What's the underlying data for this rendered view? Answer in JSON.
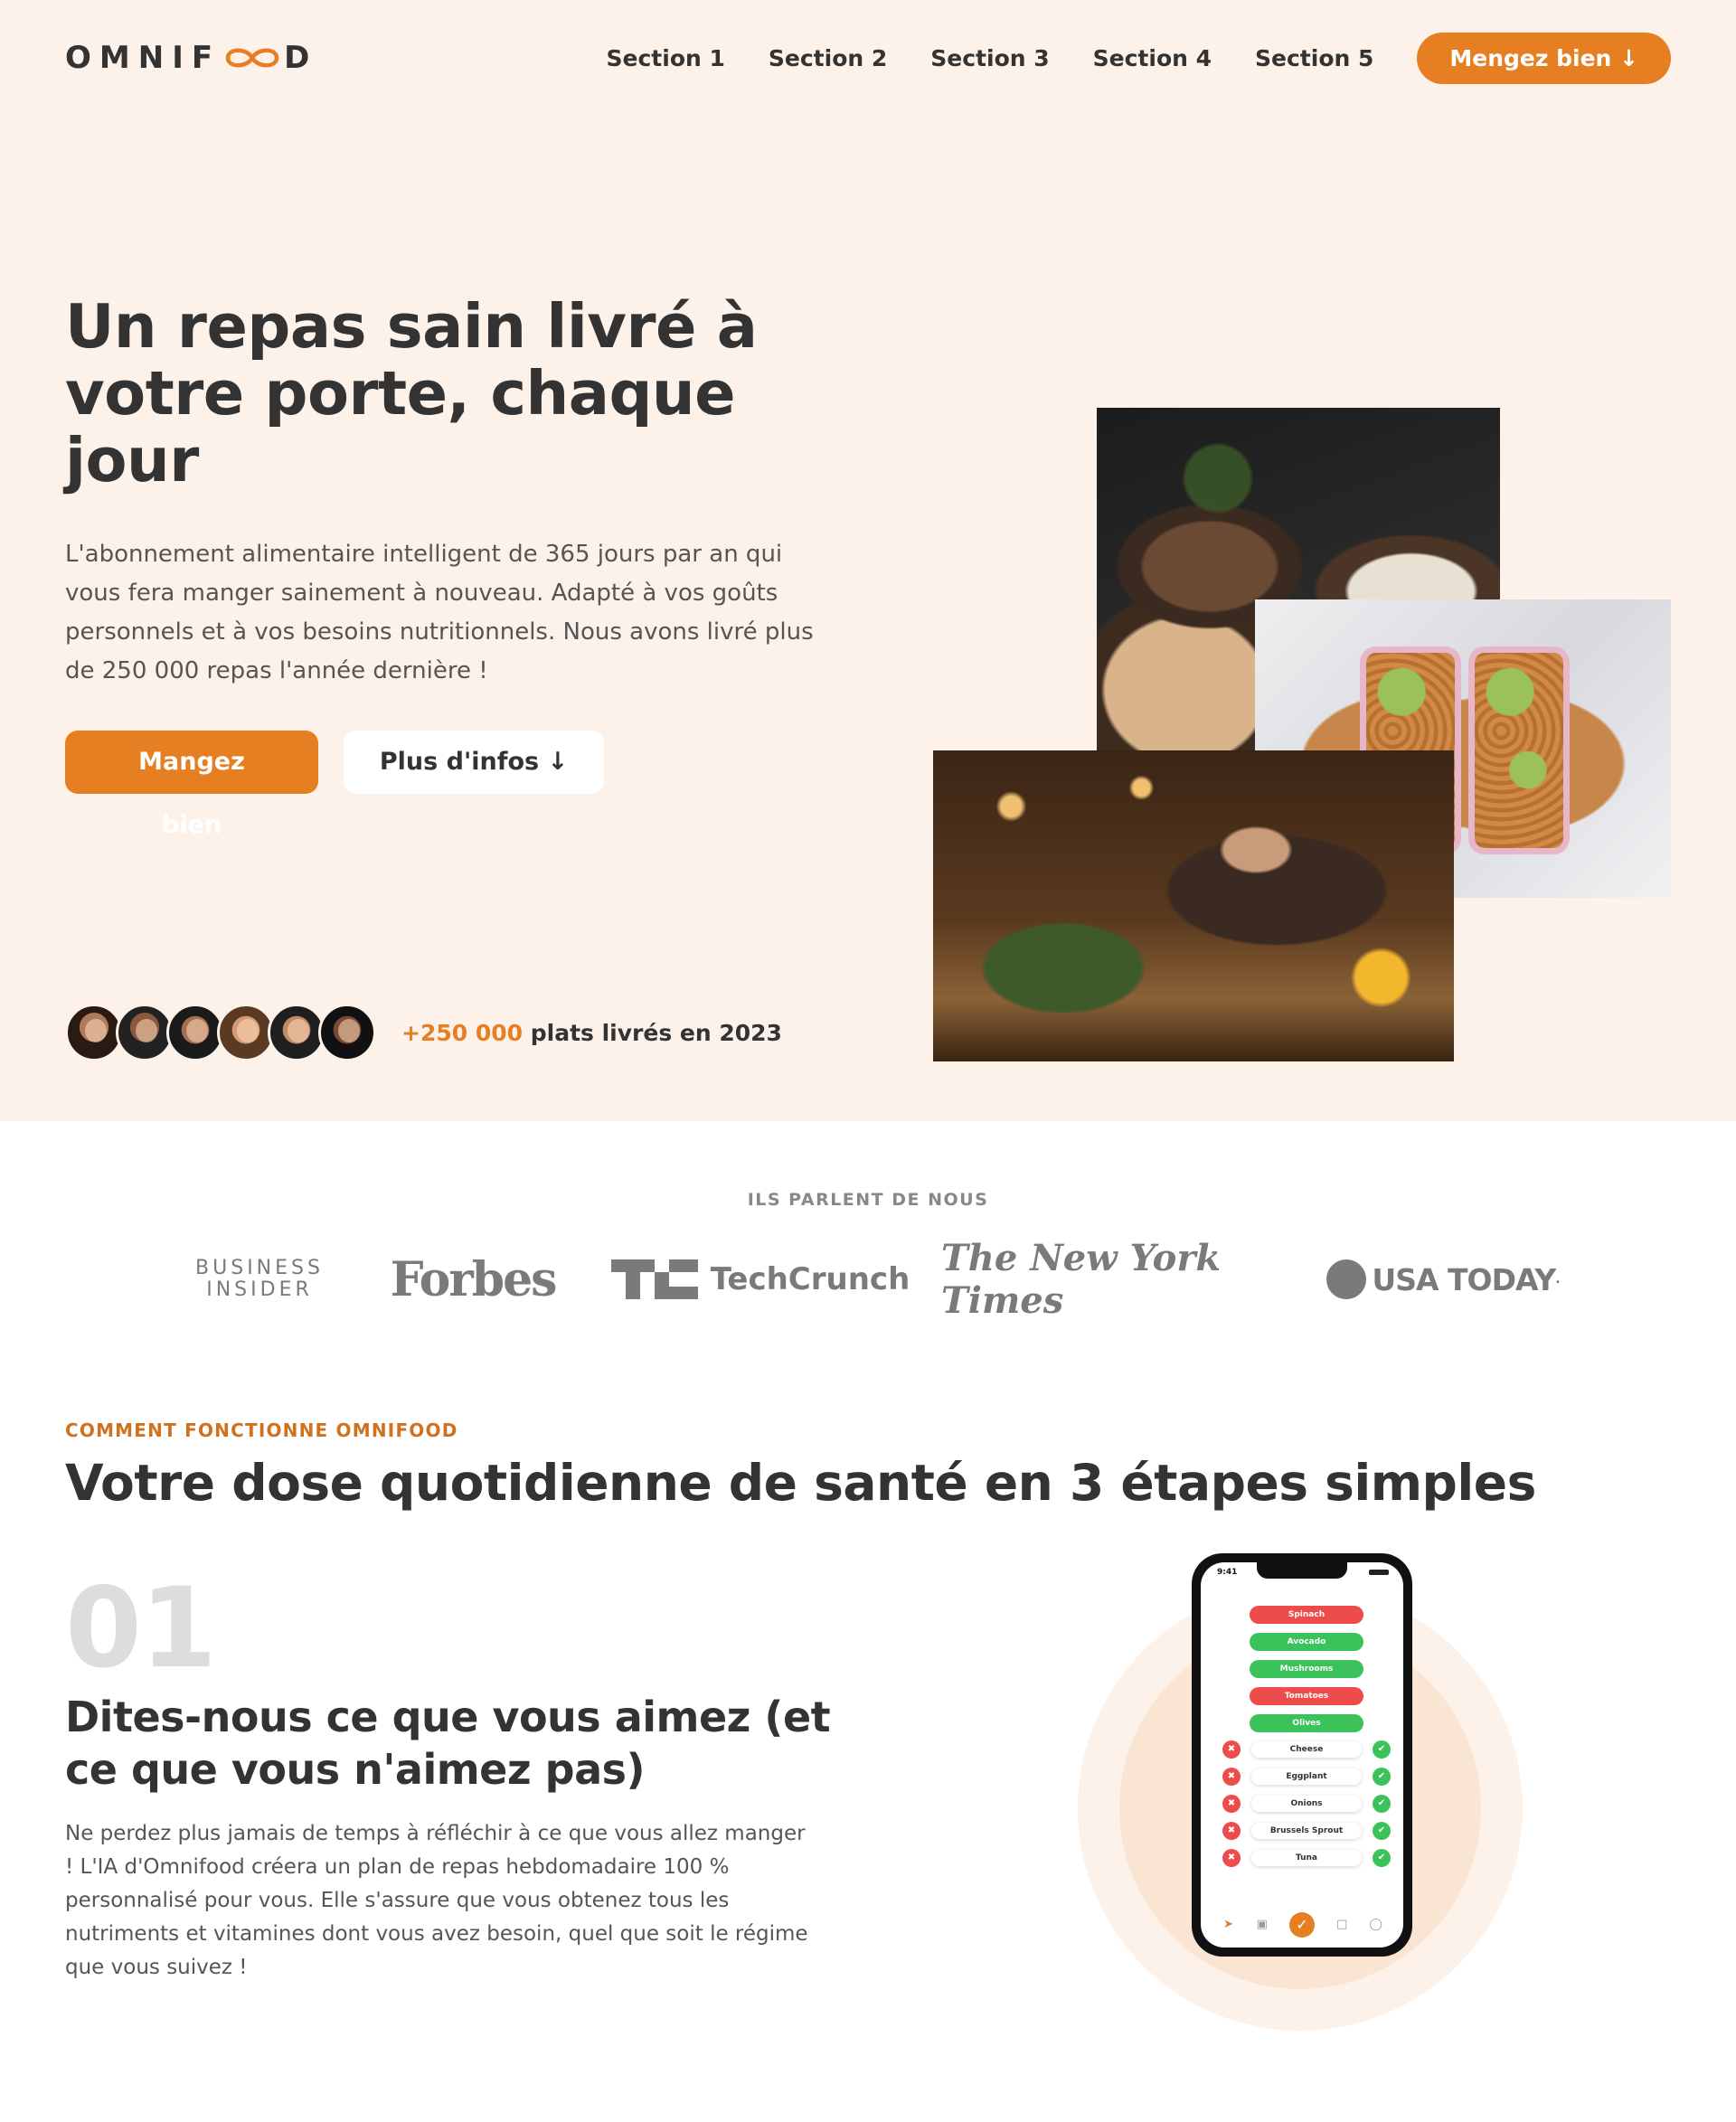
{
  "header": {
    "logo_left": "OMNIF",
    "logo_right": "D",
    "nav": [
      "Section 1",
      "Section 2",
      "Section 3",
      "Section 4",
      "Section 5"
    ],
    "cta": "Mengez bien ↓"
  },
  "hero": {
    "title": "Un repas sain livré à votre porte, chaque jour",
    "description": "L'abonnement alimentaire intelligent de 365 jours par an qui vous fera manger sainement à nouveau. Adapté à vos goûts personnels et à vos besoins nutritionnels. Nous avons livré plus de 250 000 repas l'année dernière !",
    "btn_primary": "Mangez bien",
    "btn_secondary": "Plus d'infos ↓",
    "delivered_number": "+250 000",
    "delivered_text": " plats livrés en 2023"
  },
  "featured": {
    "title": "ILS PARLENT DE NOUS",
    "logos": {
      "bi_line1": "BUSINESS",
      "bi_line2": "INSIDER",
      "forbes": "Forbes",
      "techcrunch": "TechCrunch",
      "nyt": "The New York Times",
      "usatoday": "USA TODAY",
      "usatoday_mark": "."
    }
  },
  "how": {
    "subheading": "COMMENT FONCTIONNE OMNIFOOD",
    "title": "Votre dose quotidienne de santé en 3 étapes simples",
    "step_number": "01",
    "step_title": "Dites-nous ce que vous aimez (et ce que vous n'aimez pas)",
    "step_description": "Ne perdez plus jamais de temps à réfléchir à ce que vous allez manger ! L'IA d'Omnifood créera un plan de repas hebdomadaire 100 % personnalisé pour vous. Elle s'assure que vous obtenez tous les nutriments et vitamines dont vous avez besoin, quel que soit le régime que vous suivez !"
  },
  "phone": {
    "time": "9:41",
    "pills": [
      {
        "label": "Spinach",
        "status": "red"
      },
      {
        "label": "Avocado",
        "status": "green"
      },
      {
        "label": "Mushrooms",
        "status": "green"
      },
      {
        "label": "Tomatoes",
        "status": "red"
      },
      {
        "label": "Olives",
        "status": "green"
      }
    ],
    "rows": [
      "Cheese",
      "Eggplant",
      "Onions",
      "Brussels Sprout",
      "Tuna"
    ]
  },
  "colors": {
    "primary": "#e67e22",
    "hero_bg": "#fdf2e9",
    "text": "#333333",
    "subheading": "#cf711f"
  }
}
